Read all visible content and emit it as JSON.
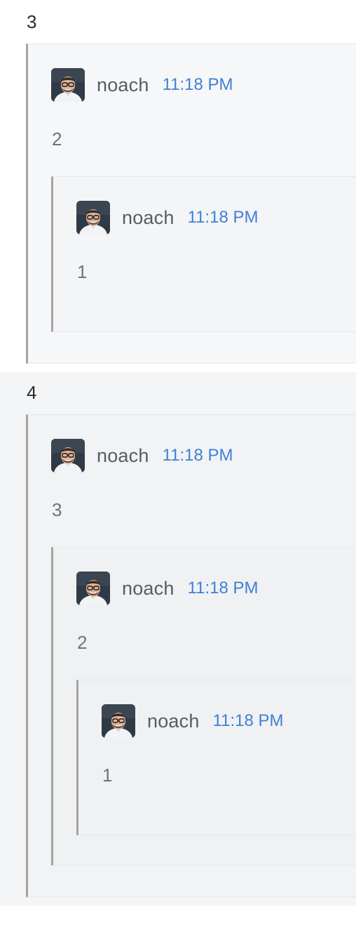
{
  "messages": [
    {
      "body": "3",
      "quote": {
        "author": "noach",
        "time": "11:18 PM",
        "text": "2",
        "quote": {
          "author": "noach",
          "time": "11:18 PM",
          "text": "1"
        }
      }
    },
    {
      "body": "4",
      "quote": {
        "author": "noach",
        "time": "11:18 PM",
        "text": "3",
        "quote": {
          "author": "noach",
          "time": "11:18 PM",
          "text": "2",
          "quote": {
            "author": "noach",
            "time": "11:18 PM",
            "text": "1"
          }
        }
      }
    }
  ],
  "colors": {
    "quote_border": "#a3a3a3",
    "author": "#585c63",
    "timestamp": "#3f7fd6",
    "quote_text": "#6f7278",
    "message_text": "#2b2b2b"
  },
  "icons": {
    "avatar": "user-avatar-photo"
  }
}
